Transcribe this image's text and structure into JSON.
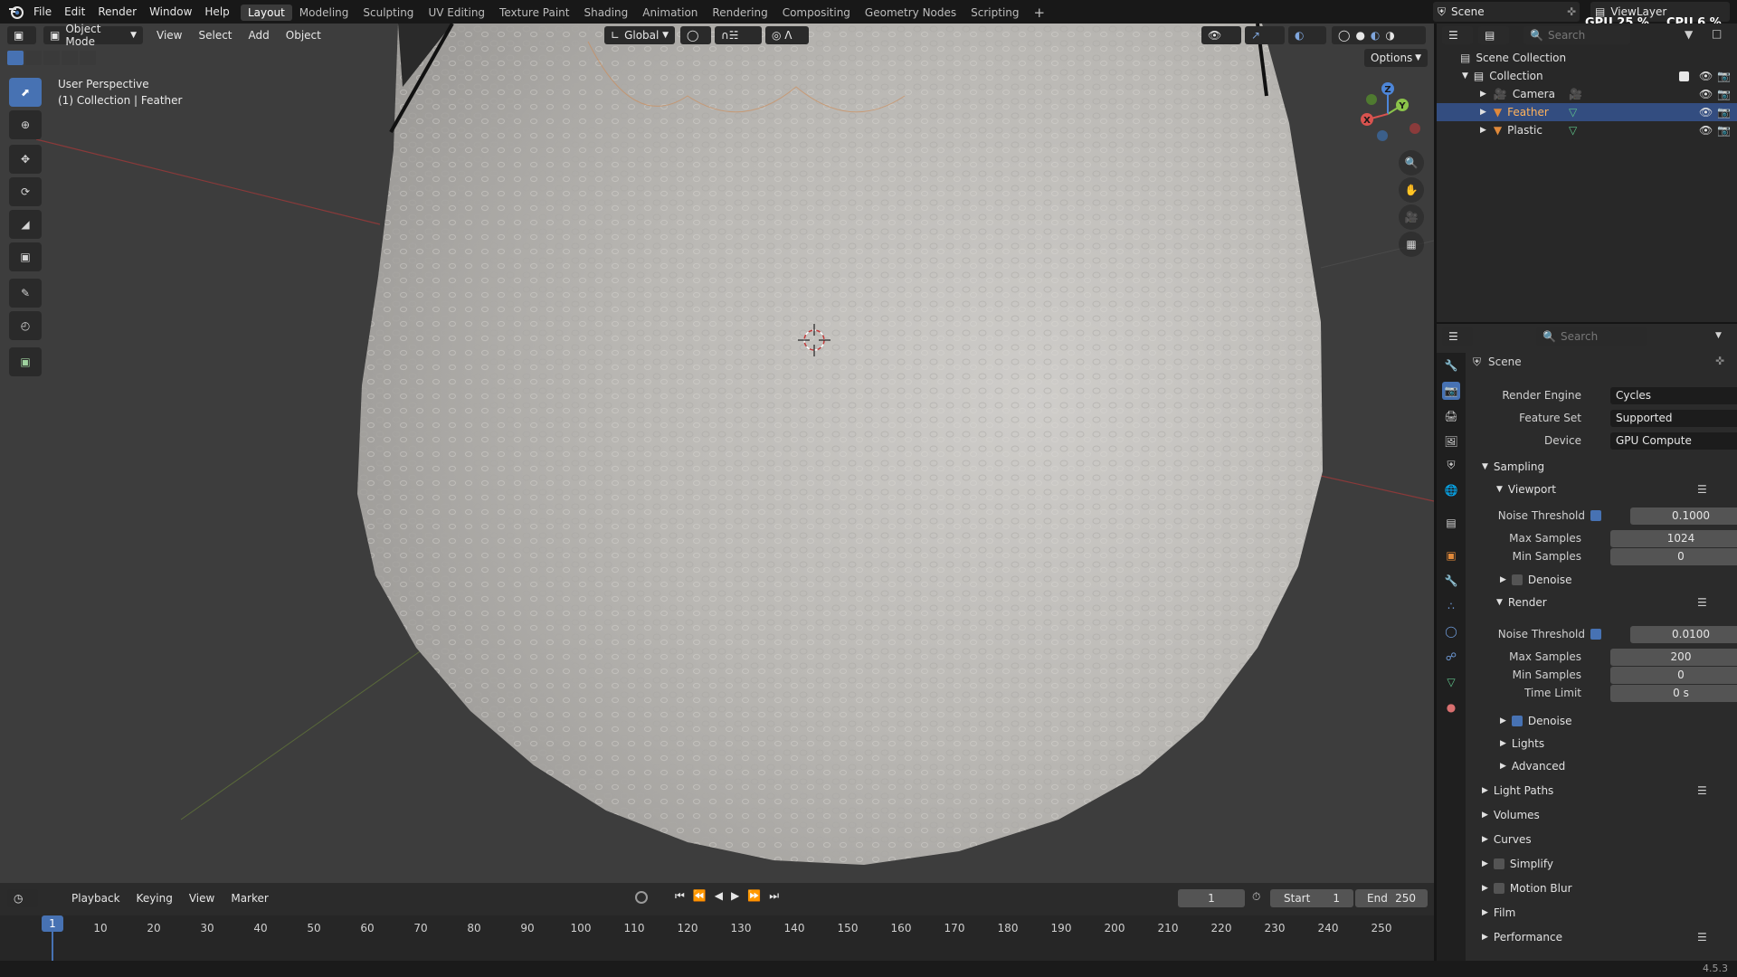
{
  "menubar": {
    "items": [
      "File",
      "Edit",
      "Render",
      "Window",
      "Help"
    ]
  },
  "workspaces": {
    "tabs": [
      "Layout",
      "Modeling",
      "Sculpting",
      "UV Editing",
      "Texture Paint",
      "Shading",
      "Animation",
      "Rendering",
      "Compositing",
      "Geometry Nodes",
      "Scripting"
    ],
    "active": "Layout",
    "add": "+"
  },
  "scene": {
    "name": "Scene",
    "view_layer": "ViewLayer"
  },
  "stats": {
    "gpu": "GPU 25 %",
    "cpu": "CPU 6 %"
  },
  "viewport": {
    "mode": "Object Mode",
    "menus": [
      "View",
      "Select",
      "Add",
      "Object"
    ],
    "transform_orientation": "Global",
    "options": "Options",
    "info_line1": "User Perspective",
    "info_line2": "(1) Collection | Feather",
    "gizmo": {
      "x": "X",
      "y": "Y",
      "z": "Z"
    }
  },
  "toolbar": {
    "tools": [
      "select-box",
      "cursor",
      "move",
      "rotate",
      "scale",
      "transform",
      "annotate",
      "measure",
      "add-cube"
    ]
  },
  "timeline": {
    "menus": [
      "Playback",
      "Keying",
      "View",
      "Marker"
    ],
    "current_frame": "1",
    "start_label": "Start",
    "start_value": "1",
    "end_label": "End",
    "end_value": "250",
    "ticks": [
      "1",
      "10",
      "20",
      "30",
      "40",
      "50",
      "60",
      "70",
      "80",
      "90",
      "100",
      "110",
      "120",
      "130",
      "140",
      "150",
      "160",
      "170",
      "180",
      "190",
      "200",
      "210",
      "220",
      "230",
      "240",
      "250"
    ]
  },
  "outliner": {
    "search_placeholder": "Search",
    "root": "Scene Collection",
    "collection": "Collection",
    "items": [
      {
        "name": "Camera",
        "selected": false
      },
      {
        "name": "Feather",
        "selected": true
      },
      {
        "name": "Plastic",
        "selected": false
      }
    ]
  },
  "properties": {
    "search_placeholder": "Search",
    "context": "Scene",
    "render_engine_label": "Render Engine",
    "render_engine": "Cycles",
    "feature_set_label": "Feature Set",
    "feature_set": "Supported",
    "device_label": "Device",
    "device": "GPU Compute",
    "sampling": "Sampling",
    "viewport_sub": "Viewport",
    "vp_noise_label": "Noise Threshold",
    "vp_noise": "0.1000",
    "vp_max_label": "Max Samples",
    "vp_max": "1024",
    "vp_min_label": "Min Samples",
    "vp_min": "0",
    "vp_denoise": "Denoise",
    "render_sub": "Render",
    "r_noise_label": "Noise Threshold",
    "r_noise": "0.0100",
    "r_max_label": "Max Samples",
    "r_max": "200",
    "r_min_label": "Min Samples",
    "r_min": "0",
    "r_time_label": "Time Limit",
    "r_time": "0 s",
    "r_denoise": "Denoise",
    "lights": "Lights",
    "advanced": "Advanced",
    "sections": [
      "Light Paths",
      "Volumes",
      "Curves",
      "Simplify",
      "Motion Blur",
      "Film",
      "Performance"
    ]
  },
  "status": {
    "version": "4.5.3"
  },
  "colors": {
    "accent": "#4772b3",
    "selected_row": "#334d80",
    "object_orange": "#e0893a",
    "mesh_green": "#5fc28a"
  }
}
